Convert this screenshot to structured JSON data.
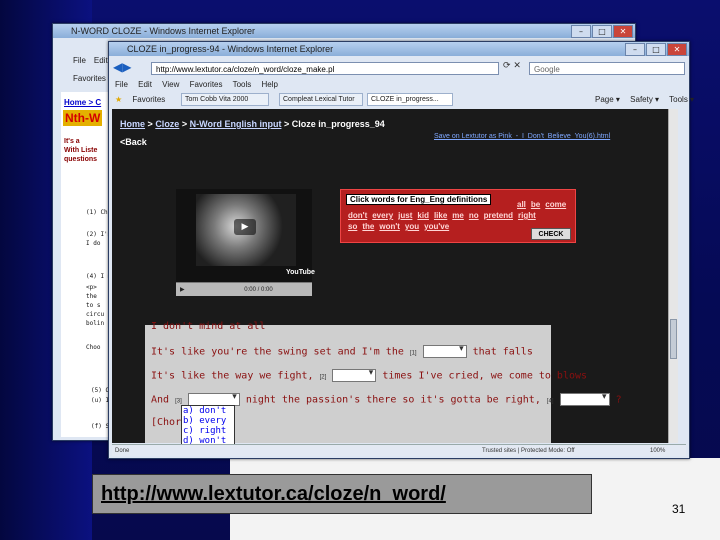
{
  "slide": {
    "url": "http://www.lextutor.ca/cloze/n_word/",
    "page_number": "31"
  },
  "back_window": {
    "title": "N-WORD CLOZE - Windows Internet Explorer",
    "menu": [
      "File",
      "Edit"
    ],
    "favorites": "Favorites",
    "breadcrumb": "Home > C",
    "heading": "Nth-W",
    "lines": [
      "It's a",
      "With Liste",
      "questions"
    ],
    "items": [
      "(1) Ch",
      "(2) I'm",
      "I do",
      "(4) I m",
      "<p>",
      "the",
      "to s",
      "circu",
      "bolin",
      "Choo",
      "(5) O",
      "(u) I",
      "(f) Sc"
    ]
  },
  "front_window": {
    "title": "CLOZE in_progress-94 - Windows Internet Explorer",
    "address": "http://www.lextutor.ca/cloze/n_word/cloze_make.pl",
    "search_placeholder": "Google",
    "menu": [
      "File",
      "Edit",
      "View",
      "Favorites",
      "Tools",
      "Help"
    ],
    "favorites_label": "Favorites",
    "tabs": [
      "Tom Cobb Vita 2000",
      "Compleat Lexical Tutor",
      "CLOZE in_progress..."
    ],
    "toolbar": [
      "Page ▾",
      "Safety ▾",
      "Tools ▾"
    ],
    "nav": {
      "home": "Home",
      "cloze": "Cloze",
      "nword": "N-Word English input",
      "current": "> Cloze in_progress_94",
      "sep": ">"
    },
    "back_link": "<Back",
    "save_link": "Save on Lextutor as Pink_-_I_Don't_Believe_You(6).html",
    "video": {
      "time": "0:00 / 0:00",
      "brand": "YouTube"
    },
    "definitions": {
      "header": "Click words for Eng_Eng definitions",
      "words": [
        "all",
        "be",
        "come",
        "don't",
        "every",
        "just",
        "kid",
        "like",
        "me",
        "no",
        "pretend",
        "right",
        "so",
        "the",
        "won't",
        "you",
        "you've"
      ],
      "check": "CHECK"
    },
    "lyrics": [
      {
        "text": "I don't mind at all"
      },
      {
        "pre": "It's like you're the swing set and I'm the",
        "num": "[1]",
        "post": "that falls"
      },
      {
        "pre": "It's like the way we fight,",
        "num": "[2]",
        "post": "times I've cried, we come to blows"
      },
      {
        "pre": "And",
        "num": "[3]",
        "mid": "night the passion's there so it's gotta be right,",
        "num2": "[4]",
        "post": "?"
      },
      {
        "text": "[Chorus"
      }
    ],
    "dropdown_options": [
      "a) don't",
      "b) every",
      "c) right",
      "d) won't"
    ],
    "status": {
      "left": "Done",
      "zone": "Trusted sites | Protected Mode: Off",
      "zoom": "100%"
    }
  }
}
